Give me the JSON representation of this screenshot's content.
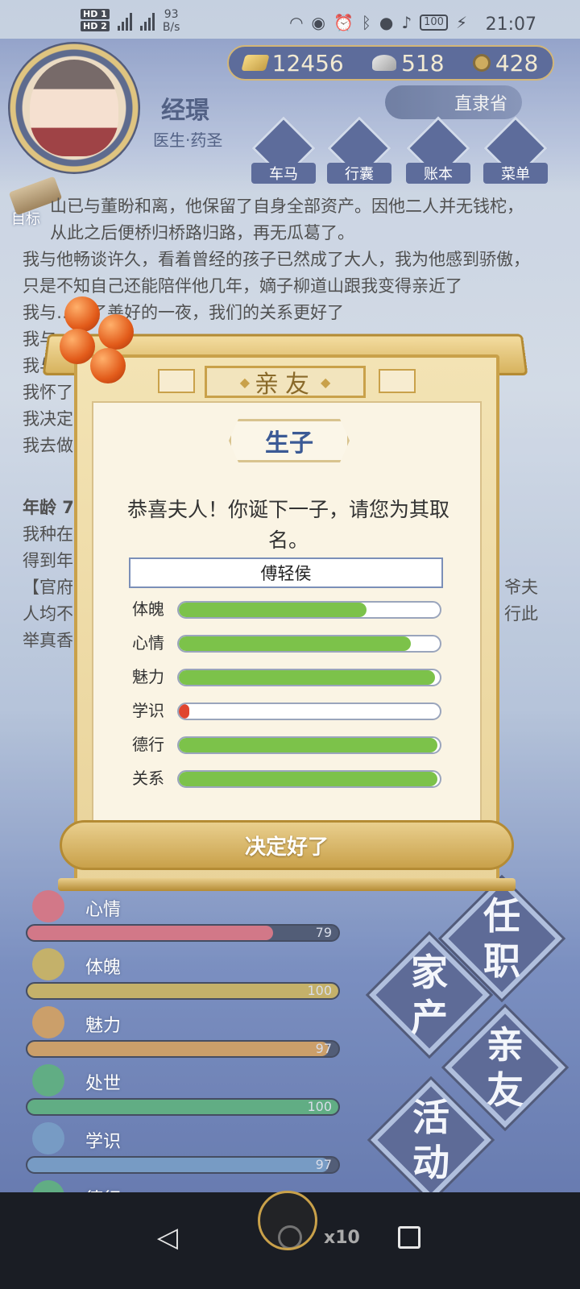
{
  "status_bar": {
    "network_speed": "93",
    "network_unit": "B/s",
    "time": "21:07",
    "battery": "100",
    "hd1": "HD 1",
    "hd2": "HD 2"
  },
  "character": {
    "name": "经璟",
    "title": "医生·药圣",
    "province": "直隶省"
  },
  "currency": {
    "gold": "12456",
    "silver": "518",
    "coin": "428"
  },
  "top_menu": [
    {
      "label": "车马",
      "icon": "carriage-icon"
    },
    {
      "label": "行囊",
      "icon": "bag-icon"
    },
    {
      "label": "账本",
      "icon": "ledger-icon"
    },
    {
      "label": "菜单",
      "icon": "menu-dots-icon"
    }
  ],
  "goal_label": "目标",
  "story": {
    "line1": "山已与董盼和离，他保留了自身全部资产。因他二人并无钱柁，从此之后便桥归桥路归路，再无瓜葛了。",
    "line2": "我与他畅谈许久，看着曾经的孩子已然成了大人，我为他感到骄傲，只是不知自己还能陪伴他几年，嫡子柳道山跟我变得亲近了",
    "line3": "我与……了善好的一夜，我们的关系更好了",
    "line4": "我与",
    "line5": "我与",
    "line6": "我怀了",
    "line7": "我决定",
    "line8": "我去做",
    "age": "年龄 7",
    "line9": "我种在",
    "line10": "得到年",
    "line11": "【官府",
    "line11_right": "爷夫",
    "line12": "人均不",
    "line12_right": "行此",
    "line13": "举真香"
  },
  "dialog": {
    "header": "亲友",
    "title": "生子",
    "message": "恭喜夫人！你诞下一子，请您为其取名。",
    "name_value": "傅轻侯",
    "confirm_label": "决定好了",
    "attributes": [
      {
        "label": "体魄",
        "value": 0.72,
        "color": "#7cc24a"
      },
      {
        "label": "心情",
        "value": 0.89,
        "color": "#7cc24a"
      },
      {
        "label": "魅力",
        "value": 0.98,
        "color": "#7cc24a"
      },
      {
        "label": "学识",
        "value": 0.04,
        "color": "#e0452e"
      },
      {
        "label": "德行",
        "value": 0.99,
        "color": "#7cc24a"
      },
      {
        "label": "关系",
        "value": 0.99,
        "color": "#7cc24a"
      }
    ]
  },
  "stats": [
    {
      "label": "心情",
      "value": "79",
      "fraction": 0.79,
      "color": "#c95b6e",
      "icon": "flower-icon"
    },
    {
      "label": "体魄",
      "value": "100",
      "fraction": 1.0,
      "color": "#b8a04a",
      "icon": "lantern-icon"
    },
    {
      "label": "魅力",
      "value": "97",
      "fraction": 0.97,
      "color": "#c08a4a",
      "icon": "jade-icon"
    },
    {
      "label": "处世",
      "value": "100",
      "fraction": 1.0,
      "color": "#3f9c6a",
      "icon": "scroll-icon"
    },
    {
      "label": "学识",
      "value": "97",
      "fraction": 0.97,
      "color": "#5a86b8",
      "icon": "books-icon"
    },
    {
      "label": "德行",
      "value": "",
      "fraction": 0.0,
      "color": "#3f9c6a",
      "icon": "virtue-icon"
    }
  ],
  "side_buttons": {
    "job_top": "任",
    "job_bottom": "职",
    "estate_top": "家",
    "estate_bottom": "产",
    "family_top": "亲",
    "family_bottom": "友",
    "activity_top": "活",
    "activity_bottom": "动"
  },
  "float_count": "x10"
}
